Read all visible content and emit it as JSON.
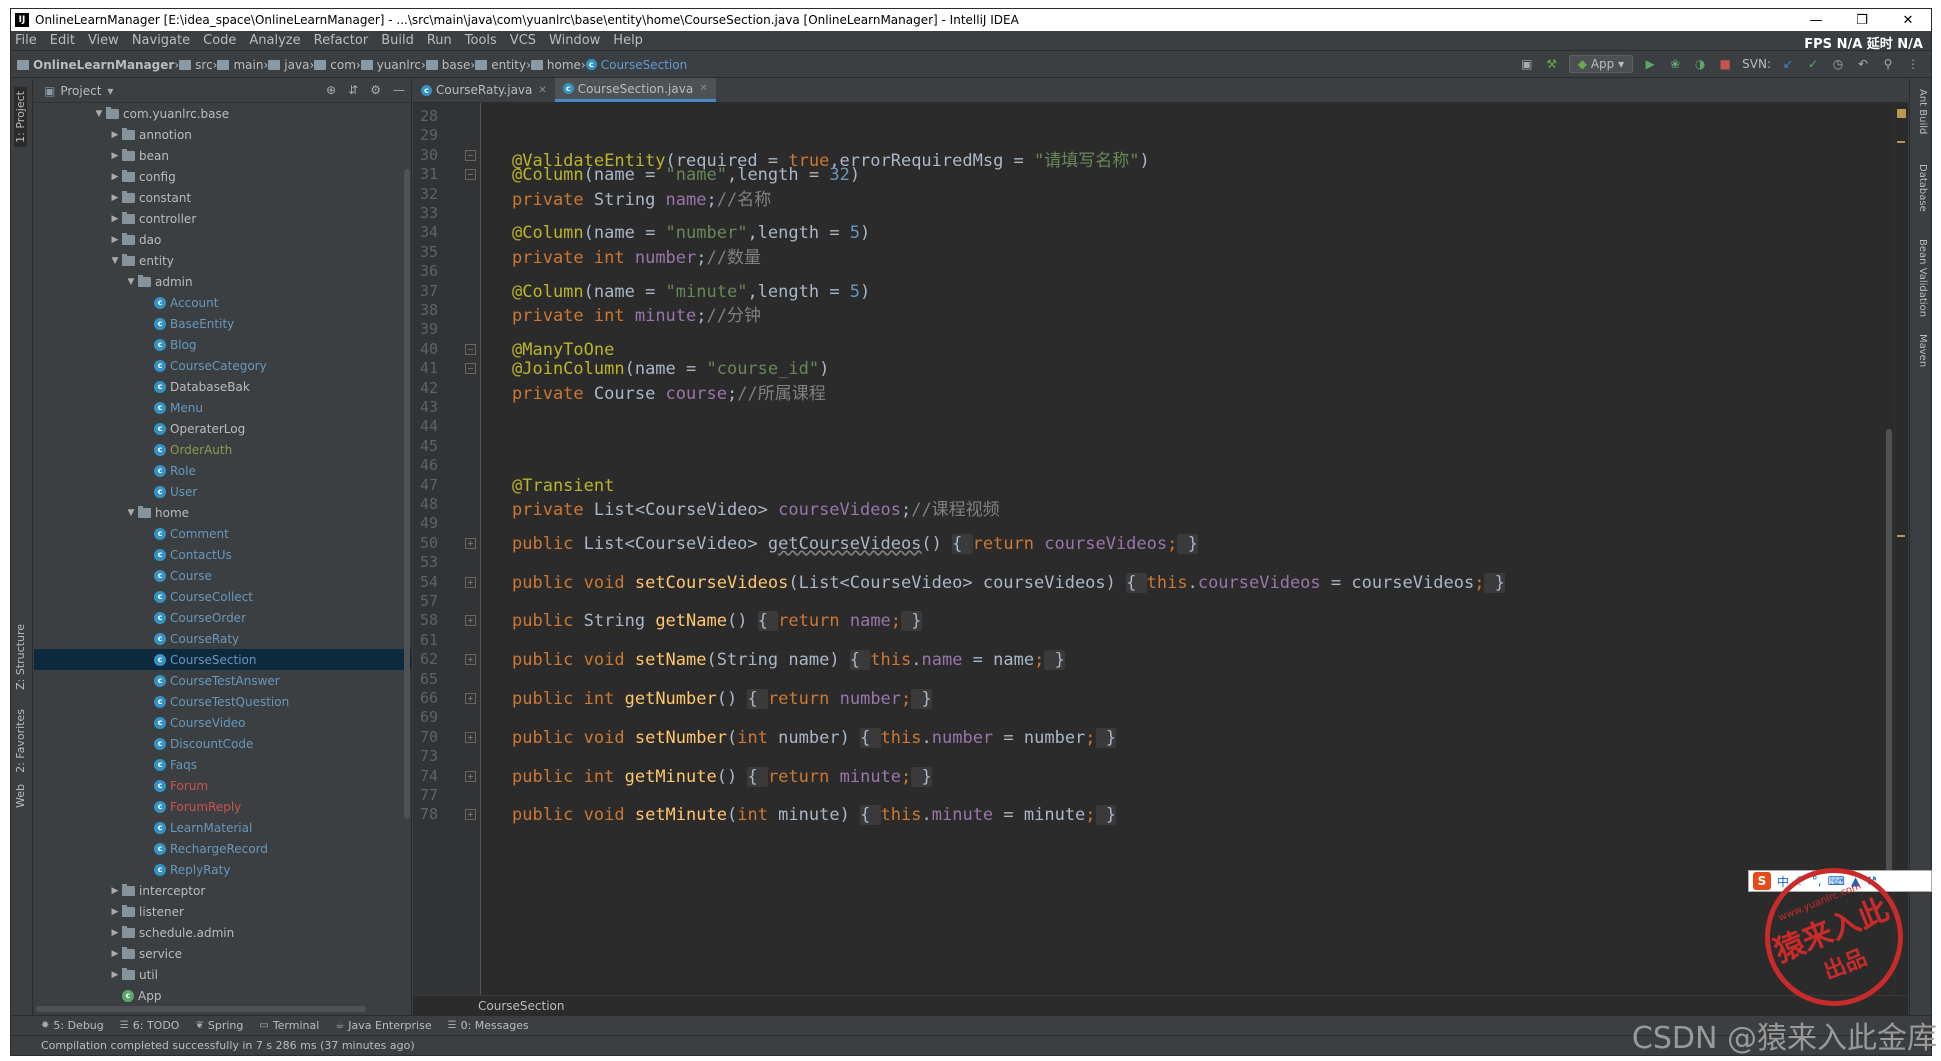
{
  "window": {
    "title": "OnlineLearnManager [E:\\idea_space\\OnlineLearnManager] - ...\\src\\main\\java\\com\\yuanlrc\\base\\entity\\home\\CourseSection.java [OnlineLearnManager] - IntelliJ IDEA",
    "app_icon": "IJ"
  },
  "menu": [
    "File",
    "Edit",
    "View",
    "Navigate",
    "Code",
    "Analyze",
    "Refactor",
    "Build",
    "Run",
    "Tools",
    "VCS",
    "Window",
    "Help"
  ],
  "menu_right": "FPS N/A 延时 N/A",
  "breadcrumbs": [
    "OnlineLearnManager",
    "src",
    "main",
    "java",
    "com",
    "yuanlrc",
    "base",
    "entity",
    "home",
    "CourseSection"
  ],
  "run_config": "App",
  "svn_label": "SVN:",
  "project_panel": {
    "title": "Project",
    "tree": [
      {
        "label": "com.yuanlrc.base",
        "indent": 0,
        "type": "package",
        "open": true
      },
      {
        "label": "annotion",
        "indent": 1,
        "type": "folder"
      },
      {
        "label": "bean",
        "indent": 1,
        "type": "folder"
      },
      {
        "label": "config",
        "indent": 1,
        "type": "folder"
      },
      {
        "label": "constant",
        "indent": 1,
        "type": "folder"
      },
      {
        "label": "controller",
        "indent": 1,
        "type": "folder"
      },
      {
        "label": "dao",
        "indent": 1,
        "type": "folder"
      },
      {
        "label": "entity",
        "indent": 1,
        "type": "folder",
        "open": true
      },
      {
        "label": "admin",
        "indent": 2,
        "type": "folder",
        "open": true
      },
      {
        "label": "Account",
        "indent": 3,
        "type": "class",
        "color": "blue"
      },
      {
        "label": "BaseEntity",
        "indent": 3,
        "type": "class",
        "color": "blue"
      },
      {
        "label": "Blog",
        "indent": 3,
        "type": "class",
        "color": "blue"
      },
      {
        "label": "CourseCategory",
        "indent": 3,
        "type": "class",
        "color": "blue"
      },
      {
        "label": "DatabaseBak",
        "indent": 3,
        "type": "class",
        "color": "norm"
      },
      {
        "label": "Menu",
        "indent": 3,
        "type": "class",
        "color": "blue"
      },
      {
        "label": "OperaterLog",
        "indent": 3,
        "type": "class",
        "color": "norm"
      },
      {
        "label": "OrderAuth",
        "indent": 3,
        "type": "class",
        "color": "olive"
      },
      {
        "label": "Role",
        "indent": 3,
        "type": "class",
        "color": "blue"
      },
      {
        "label": "User",
        "indent": 3,
        "type": "class",
        "color": "blue"
      },
      {
        "label": "home",
        "indent": 2,
        "type": "folder",
        "open": true
      },
      {
        "label": "Comment",
        "indent": 3,
        "type": "class",
        "color": "blue"
      },
      {
        "label": "ContactUs",
        "indent": 3,
        "type": "class",
        "color": "blue"
      },
      {
        "label": "Course",
        "indent": 3,
        "type": "class",
        "color": "blue"
      },
      {
        "label": "CourseCollect",
        "indent": 3,
        "type": "class",
        "color": "blue"
      },
      {
        "label": "CourseOrder",
        "indent": 3,
        "type": "class",
        "color": "blue"
      },
      {
        "label": "CourseRaty",
        "indent": 3,
        "type": "class",
        "color": "blue"
      },
      {
        "label": "CourseSection",
        "indent": 3,
        "type": "class",
        "color": "blue",
        "selected": true
      },
      {
        "label": "CourseTestAnswer",
        "indent": 3,
        "type": "class",
        "color": "blue"
      },
      {
        "label": "CourseTestQuestion",
        "indent": 3,
        "type": "class",
        "color": "blue"
      },
      {
        "label": "CourseVideo",
        "indent": 3,
        "type": "class",
        "color": "blue"
      },
      {
        "label": "DiscountCode",
        "indent": 3,
        "type": "class",
        "color": "blue"
      },
      {
        "label": "Faqs",
        "indent": 3,
        "type": "class",
        "color": "blue"
      },
      {
        "label": "Forum",
        "indent": 3,
        "type": "class",
        "color": "red"
      },
      {
        "label": "ForumReply",
        "indent": 3,
        "type": "class",
        "color": "red"
      },
      {
        "label": "LearnMaterial",
        "indent": 3,
        "type": "class",
        "color": "blue"
      },
      {
        "label": "RechargeRecord",
        "indent": 3,
        "type": "class",
        "color": "blue"
      },
      {
        "label": "ReplyRaty",
        "indent": 3,
        "type": "class",
        "color": "blue"
      },
      {
        "label": "interceptor",
        "indent": 1,
        "type": "folder"
      },
      {
        "label": "listener",
        "indent": 1,
        "type": "folder"
      },
      {
        "label": "schedule.admin",
        "indent": 1,
        "type": "folder"
      },
      {
        "label": "service",
        "indent": 1,
        "type": "folder"
      },
      {
        "label": "util",
        "indent": 1,
        "type": "folder"
      },
      {
        "label": "App",
        "indent": 1,
        "type": "class",
        "color": "norm"
      }
    ]
  },
  "left_tool_labels": [
    "1: Project",
    "Z: Structure",
    "2: Favorites",
    "Web"
  ],
  "right_tool_labels": [
    "Ant Build",
    "Database",
    "Bean Validation",
    "Maven"
  ],
  "editor": {
    "tabs": [
      {
        "label": "CourseRaty.java",
        "active": false
      },
      {
        "label": "CourseSection.java",
        "active": true
      }
    ],
    "lines": [
      {
        "n": "28",
        "html": ""
      },
      {
        "n": "29",
        "html": ""
      },
      {
        "n": "30",
        "fold": "−",
        "html": "<span class='ann'>@ValidateEntity</span>(required = <span class='kw'>true</span>,errorRequiredMsg = <span class='str'>\"请填写名称\"</span>)"
      },
      {
        "n": "31",
        "fold": "−",
        "html": "<span class='ann'>@Column</span>(name = <span class='str'>\"name\"</span>,length = <span class='num'>32</span>)"
      },
      {
        "n": "32",
        "html": "<span class='kw'>private</span> String <span class='fld'>name</span>;<span class='cmt'>//名称</span>"
      },
      {
        "n": "33",
        "html": ""
      },
      {
        "n": "34",
        "html": "<span class='ann'>@Column</span>(name = <span class='str'>\"number\"</span>,length = <span class='num'>5</span>)"
      },
      {
        "n": "35",
        "html": "<span class='kw'>private int</span> <span class='fld'>number</span>;<span class='cmt'>//数量</span>"
      },
      {
        "n": "36",
        "html": ""
      },
      {
        "n": "37",
        "html": "<span class='ann'>@Column</span>(name = <span class='str'>\"minute\"</span>,length = <span class='num'>5</span>)"
      },
      {
        "n": "38",
        "html": "<span class='kw'>private int</span> <span class='fld'>minute</span>;<span class='cmt'>//分钟</span>"
      },
      {
        "n": "39",
        "html": ""
      },
      {
        "n": "40",
        "fold": "−",
        "html": "<span class='ann'>@ManyToOne</span>"
      },
      {
        "n": "41",
        "fold": "−",
        "html": "<span class='ann'>@JoinColumn</span>(name = <span class='str'>\"course_id\"</span>)"
      },
      {
        "n": "42",
        "html": "<span class='kw'>private</span> Course <span class='fld'>course</span>;<span class='cmt'>//所属课程</span>"
      },
      {
        "n": "43",
        "html": ""
      },
      {
        "n": "44",
        "html": ""
      },
      {
        "n": "45",
        "html": ""
      },
      {
        "n": "46",
        "html": ""
      },
      {
        "n": "47",
        "html": "<span class='ann'>@Transient</span>"
      },
      {
        "n": "48",
        "html": "<span class='kw'>private</span> List&lt;CourseVideo&gt; <span class='fld'>courseVideos</span>;<span class='cmt'>//课程视频</span>"
      },
      {
        "n": "49",
        "html": ""
      },
      {
        "n": "50",
        "fold": "+",
        "html": "<span class='kw'>public</span> List&lt;CourseVideo&gt; <span style='text-decoration:underline wavy #808080'>getCourseVideos</span>() <span class='fold-bg'>{ </span><span class='kw'>return</span> <span class='fld'>courseVideos</span><span class='kw'>;</span><span class='fold-bg'> }</span>"
      },
      {
        "n": "53",
        "html": ""
      },
      {
        "n": "54",
        "fold": "+",
        "html": "<span class='kw'>public void</span> <span class='fn'>setCourseVideos</span>(List&lt;CourseVideo&gt; courseVideos) <span class='fold-bg'>{ </span><span class='kw'>this</span>.<span class='fld'>courseVideos</span> = courseVideos<span class='kw'>;</span><span class='fold-bg'> }</span>"
      },
      {
        "n": "57",
        "html": ""
      },
      {
        "n": "58",
        "fold": "+",
        "html": "<span class='kw'>public</span> String <span class='fn'>getName</span>() <span class='fold-bg'>{ </span><span class='kw'>return</span> <span class='fld'>name</span><span class='kw'>;</span><span class='fold-bg'> }</span>"
      },
      {
        "n": "61",
        "html": ""
      },
      {
        "n": "62",
        "fold": "+",
        "html": "<span class='kw'>public void</span> <span class='fn'>setName</span>(String name) <span class='fold-bg'>{ </span><span class='kw'>this</span>.<span class='fld'>name</span> = name<span class='kw'>;</span><span class='fold-bg'> }</span>"
      },
      {
        "n": "65",
        "html": ""
      },
      {
        "n": "66",
        "fold": "+",
        "html": "<span class='kw'>public int</span> <span class='fn'>getNumber</span>() <span class='fold-bg'>{ </span><span class='kw'>return</span> <span class='fld'>number</span><span class='kw'>;</span><span class='fold-bg'> }</span>"
      },
      {
        "n": "69",
        "html": ""
      },
      {
        "n": "70",
        "fold": "+",
        "html": "<span class='kw'>public void</span> <span class='fn'>setNumber</span>(<span class='kw'>int</span> number) <span class='fold-bg'>{ </span><span class='kw'>this</span>.<span class='fld'>number</span> = number<span class='kw'>;</span><span class='fold-bg'> }</span>"
      },
      {
        "n": "73",
        "html": ""
      },
      {
        "n": "74",
        "fold": "+",
        "html": "<span class='kw'>public int</span> <span class='fn'>getMinute</span>() <span class='fold-bg'>{ </span><span class='kw'>return</span> <span class='fld'>minute</span><span class='kw'>;</span><span class='fold-bg'> }</span>"
      },
      {
        "n": "77",
        "html": ""
      },
      {
        "n": "78",
        "fold": "+",
        "html": "<span class='kw'>public void</span> <span class='fn'>setMinute</span>(<span class='kw'>int</span> minute) <span class='fold-bg'>{ </span><span class='kw'>this</span>.<span class='fld'>minute</span> = minute<span class='kw'>;</span><span class='fold-bg'> }</span>"
      }
    ],
    "breadcrumb": "CourseSection"
  },
  "tool_windows": [
    {
      "icon": "bug-icon",
      "label": "5: Debug"
    },
    {
      "icon": "todo-icon",
      "label": "6: TODO"
    },
    {
      "icon": "spring-icon",
      "label": "Spring"
    },
    {
      "icon": "terminal-icon",
      "label": "Terminal"
    },
    {
      "icon": "java-enterprise-icon",
      "label": "Java Enterprise"
    },
    {
      "icon": "messages-icon",
      "label": "0: Messages"
    }
  ],
  "status_text": "Compilation completed successfully in 7 s 286 ms (37 minutes ago)",
  "watermark": "CSDN @猿来入此金库",
  "seal": {
    "main": "猿来入此",
    "sub": "出品",
    "url": "www.yuanlrc.com"
  },
  "ime_label": "中"
}
